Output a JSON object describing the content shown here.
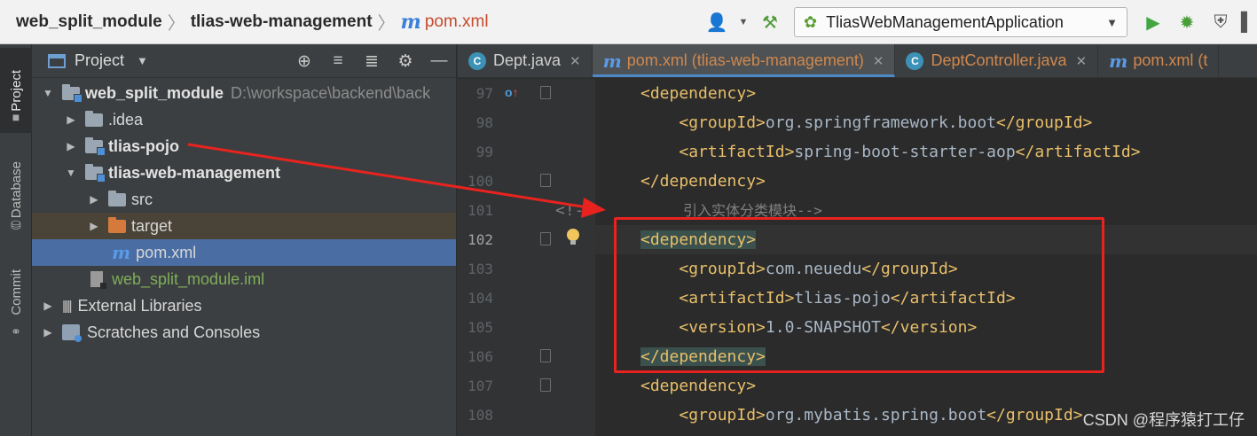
{
  "breadcrumb": {
    "items": [
      "web_split_module",
      "tlias-web-management"
    ],
    "file_icon": "m",
    "file": "pom.xml"
  },
  "toolbar": {
    "run_config": "TliasWebManagementApplication"
  },
  "side_tabs": {
    "project": "Project",
    "database": "Database",
    "commit": "Commit"
  },
  "project_panel": {
    "title": "Project"
  },
  "tree": [
    {
      "label": "web_split_module",
      "path": "D:\\workspace\\backend\\back"
    },
    {
      "label": ".idea"
    },
    {
      "label": "tlias-pojo"
    },
    {
      "label": "tlias-web-management"
    },
    {
      "label": "src"
    },
    {
      "label": "target"
    },
    {
      "label": "pom.xml",
      "icon": "m"
    },
    {
      "label": "web_split_module.iml"
    },
    {
      "label": "External Libraries"
    },
    {
      "label": "Scratches and Consoles"
    }
  ],
  "tabs": [
    {
      "icon": "C",
      "label": "Dept.java"
    },
    {
      "icon": "m",
      "label": "pom.xml (tlias-web-management)"
    },
    {
      "icon": "C",
      "label": "DeptController.java"
    },
    {
      "icon": "m",
      "label": "pom.xml (t"
    }
  ],
  "lines": [
    {
      "num": "97",
      "pre": "",
      "text": "<dependency>"
    },
    {
      "num": "98",
      "pre": "    ",
      "text": "<groupId>org.springframework.boot</groupId>"
    },
    {
      "num": "99",
      "pre": "    ",
      "text": "<artifactId>spring-boot-starter-aop</artifactId>"
    },
    {
      "num": "100",
      "pre": "",
      "text": "</dependency>"
    },
    {
      "num": "101",
      "pre": "",
      "text": "<!--    引入实体分类模块-->"
    },
    {
      "num": "102",
      "pre": "",
      "text": "<dependency>"
    },
    {
      "num": "103",
      "pre": "    ",
      "text": "<groupId>com.neuedu</groupId>"
    },
    {
      "num": "104",
      "pre": "    ",
      "text": "<artifactId>tlias-pojo</artifactId>"
    },
    {
      "num": "105",
      "pre": "    ",
      "text": "<version>1.0-SNAPSHOT</version>"
    },
    {
      "num": "106",
      "pre": "",
      "text": "</dependency>"
    },
    {
      "num": "107",
      "pre": "",
      "text": "<dependency>"
    },
    {
      "num": "108",
      "pre": "    ",
      "text": "<groupId>org.mybatis.spring.boot</groupId>"
    }
  ],
  "comment_text": "引入实体分类模块-->",
  "watermark": "CSDN @程序猿打工仔",
  "colors": {
    "highlight": "#e8231f",
    "accent": "#4a88c7",
    "tag": "#e8bf6a"
  }
}
